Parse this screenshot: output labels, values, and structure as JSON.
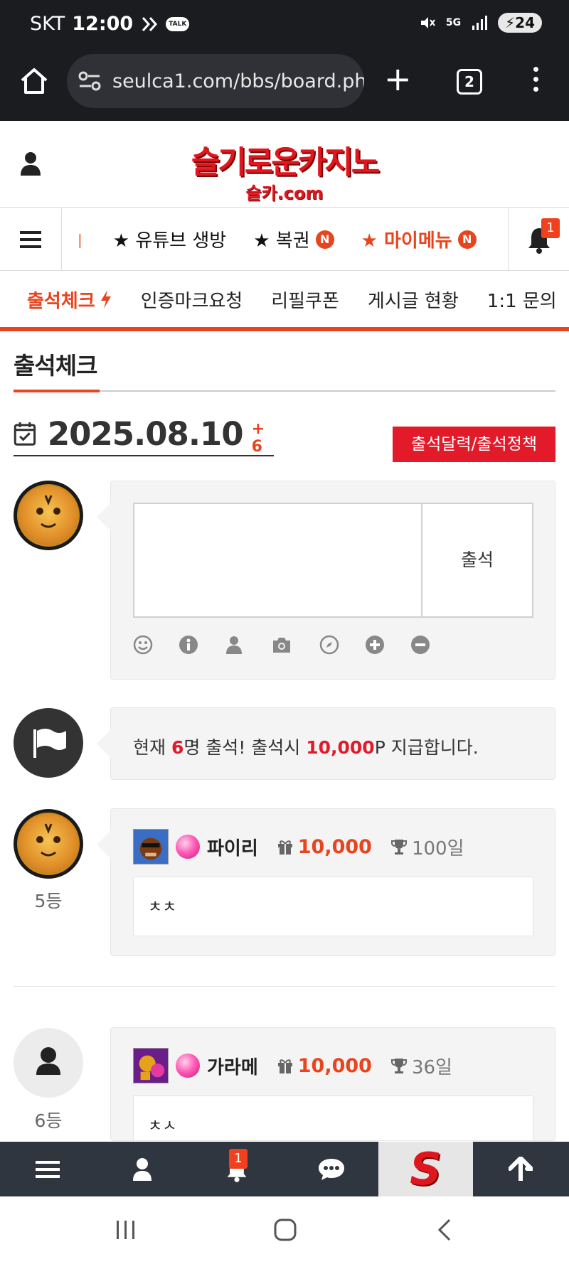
{
  "status_bar": {
    "carrier": "SKT",
    "time": "12:00",
    "talk_badge": "TALK",
    "network": "5G",
    "battery": "24"
  },
  "browser": {
    "url": "seulca1.com/bbs/board.php",
    "tab_count": "2"
  },
  "header": {
    "logo_main": "슬기로운카지노",
    "logo_sub": "슬카.com"
  },
  "top_nav": {
    "items": [
      {
        "label": "★ 유튜브 생방",
        "badge": ""
      },
      {
        "label": "★ 복권",
        "badge": "N"
      },
      {
        "label": "★ 마이메뉴",
        "badge": "N"
      }
    ],
    "bell_badge": "1"
  },
  "sub_nav": {
    "items": [
      "출석체크",
      "인증마크요청",
      "리필쿠폰",
      "게시글 현황",
      "1:1 문의"
    ]
  },
  "page": {
    "title": "출석체크",
    "date": "2025.08.10",
    "date_extra": "+ 6",
    "calendar_button": "출석달력/출석정책"
  },
  "write_form": {
    "textarea_value": "",
    "submit_label": "출석"
  },
  "notice": {
    "prefix": "현재 ",
    "count": "6",
    "middle": "명 출석! 출석시 ",
    "points": "10,000",
    "suffix": "P 지급합니다."
  },
  "entries": [
    {
      "rank": "5등",
      "name": "파이리",
      "points": "10,000",
      "days": "100일",
      "comment": "ㅊㅊ"
    },
    {
      "rank": "6등",
      "name": "가라메",
      "points": "10,000",
      "days": "36일",
      "comment": "ㅊㅅ"
    }
  ],
  "bottom_bar": {
    "notification_badge": "1",
    "logo_letter": "S"
  },
  "colors": {
    "accent": "#e8441e",
    "brand_red": "#e0161e",
    "button_red": "#e21a2a",
    "bottom_bar": "#2f3640"
  }
}
